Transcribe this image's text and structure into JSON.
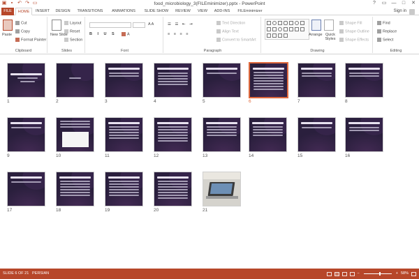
{
  "window": {
    "title": "food_microbiology_3(FILEminimizer).pptx - PowerPoint",
    "controls": [
      "?",
      "▭",
      "—",
      "□",
      "✕"
    ]
  },
  "tabs": [
    "FILE",
    "HOME",
    "INSERT",
    "DESIGN",
    "TRANSITIONS",
    "ANIMATIONS",
    "SLIDE SHOW",
    "REVIEW",
    "VIEW",
    "ADD-INS",
    "FILEminimizer"
  ],
  "active_tab": "HOME",
  "signin": "Sign in",
  "ribbon": {
    "clipboard": {
      "paste": "Paste",
      "cut": "Cut",
      "copy": "Copy",
      "format_painter": "Format Painter",
      "label": "Clipboard"
    },
    "slides": {
      "new_slide": "New Slide",
      "layout": "Layout",
      "reset": "Reset",
      "section": "Section",
      "label": "Slides"
    },
    "font": {
      "label": "Font"
    },
    "paragraph": {
      "text_direction": "Text Direction",
      "align_text": "Align Text",
      "smartart": "Convert to SmartArt",
      "label": "Paragraph"
    },
    "drawing": {
      "arrange": "Arrange",
      "quick_styles": "Quick Styles",
      "shape_fill": "Shape Fill",
      "shape_outline": "Shape Outline",
      "shape_effects": "Shape Effects",
      "label": "Drawing"
    },
    "editing": {
      "find": "Find",
      "replace": "Replace",
      "select": "Select",
      "label": "Editing"
    }
  },
  "slides": [
    {
      "n": "1"
    },
    {
      "n": "2"
    },
    {
      "n": "3"
    },
    {
      "n": "4"
    },
    {
      "n": "5"
    },
    {
      "n": "6"
    },
    {
      "n": "7"
    },
    {
      "n": "8"
    },
    {
      "n": "9"
    },
    {
      "n": "10"
    },
    {
      "n": "11"
    },
    {
      "n": "12"
    },
    {
      "n": "13"
    },
    {
      "n": "14"
    },
    {
      "n": "15"
    },
    {
      "n": "16"
    },
    {
      "n": "17"
    },
    {
      "n": "18"
    },
    {
      "n": "19"
    },
    {
      "n": "20"
    },
    {
      "n": "21"
    }
  ],
  "selected_slide": "6",
  "status": {
    "slide_info": "SLIDE 6 OF 21",
    "language": "PERSIAN",
    "zoom": "58%"
  },
  "colors": {
    "accent": "#b7472a",
    "selection": "#e06a3e",
    "slide_bg": "#2a1f3d"
  }
}
